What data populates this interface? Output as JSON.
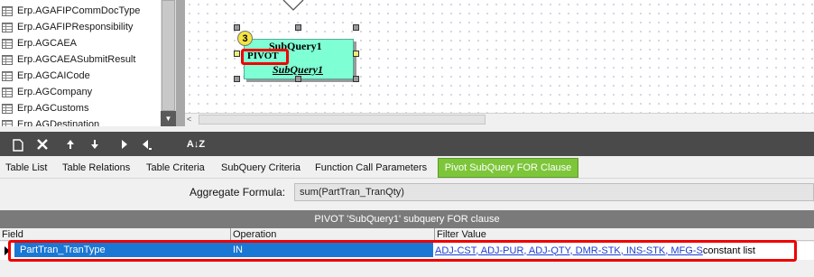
{
  "table_list": {
    "items": [
      "Erp.AGAFIPCommDocType",
      "Erp.AGAFIPResponsibility",
      "Erp.AGCAEA",
      "Erp.AGCAEASubmitResult",
      "Erp.AGCAICode",
      "Erp.AGCompany",
      "Erp.AGCustoms",
      "Erp.AGDestination"
    ],
    "scroll_down_glyph": "▼"
  },
  "canvas": {
    "node_title": "SubQuery1",
    "node_pivot_label": "PIVOT",
    "node_subtitle": "SubQuery1",
    "badge_number": "3",
    "scroll_left_glyph": "<"
  },
  "toolbar": {
    "buttons": [
      "new-icon",
      "delete-icon",
      "move-up-icon",
      "move-down-icon",
      "move-right-icon",
      "move-left-icon",
      "sort-icon"
    ],
    "sort_text": "A↓Z"
  },
  "tabs": [
    "Table List",
    "Table Relations",
    "Table Criteria",
    "SubQuery Criteria",
    "Function Call Parameters",
    "Pivot SubQuery FOR Clause"
  ],
  "active_tab": "Pivot SubQuery FOR Clause",
  "aggregate": {
    "label": "Aggregate Formula:",
    "value": "sum(PartTran_TranQty)"
  },
  "grid": {
    "title": "PIVOT 'SubQuery1' subquery FOR clause",
    "columns": [
      "Field",
      "Operation",
      "Filter Value"
    ],
    "rows": [
      {
        "field": "PartTran_TranType",
        "operation": "IN",
        "filter_link": "ADJ-CST, ADJ-PUR, ADJ-QTY, DMR-STK, INS-STK, MFG-S",
        "filter_suffix": "constant list"
      }
    ]
  },
  "colors": {
    "accent_tab": "#7dc63a",
    "selection": "#1a78d4",
    "highlight_outline": "#e00000",
    "node_fill": "#7fffd4",
    "toolbar_bg": "#4a4a4a"
  }
}
